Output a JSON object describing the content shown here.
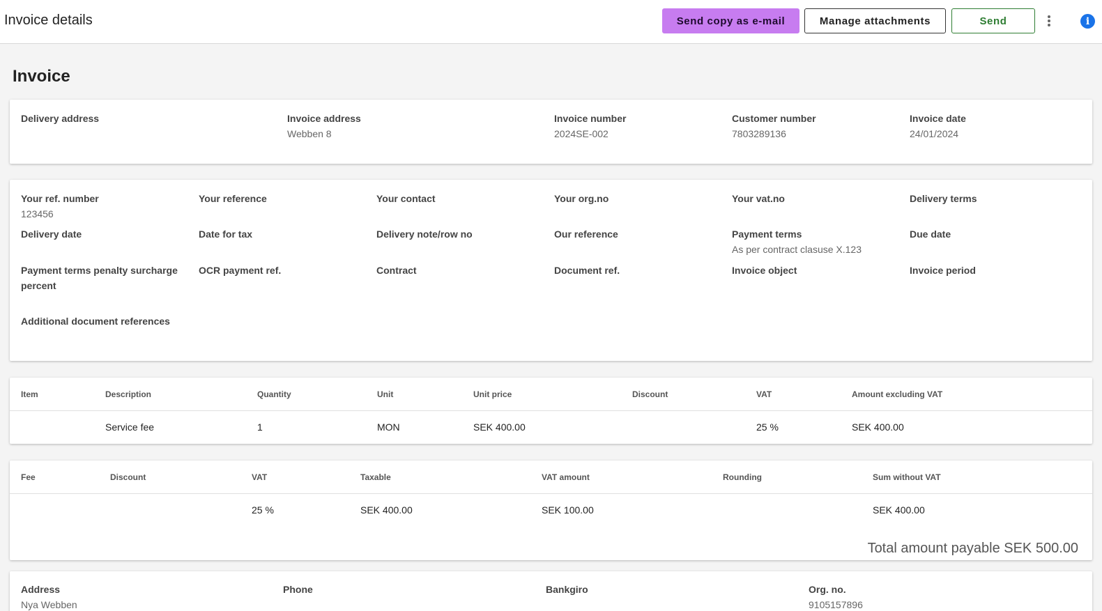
{
  "header": {
    "title": "Invoice details",
    "send_copy_label": "Send copy as e-mail",
    "manage_attachments_label": "Manage attachments",
    "send_label": "Send",
    "info_glyph": "i"
  },
  "page_title": "Invoice",
  "summary": {
    "delivery_address_label": "Delivery address",
    "invoice_address_label": "Invoice address",
    "invoice_address_value": "Webben 8",
    "invoice_number_label": "Invoice number",
    "invoice_number_value": "2024SE-002",
    "customer_number_label": "Customer number",
    "customer_number_value": "7803289136",
    "invoice_date_label": "Invoice date",
    "invoice_date_value": "24/01/2024"
  },
  "references": {
    "your_ref_number_label": "Your ref. number",
    "your_ref_number_value": "123456",
    "your_reference_label": "Your reference",
    "your_contact_label": "Your contact",
    "your_org_no_label": "Your org.no",
    "your_vat_no_label": "Your vat.no",
    "delivery_terms_label": "Delivery terms",
    "delivery_date_label": "Delivery date",
    "date_for_tax_label": "Date for tax",
    "delivery_note_label": "Delivery note/row no",
    "our_reference_label": "Our reference",
    "payment_terms_label": "Payment terms",
    "payment_terms_value": "As per contract clasuse X.123",
    "due_date_label": "Due date",
    "penalty_label_line1": "Payment terms penalty surcharge",
    "penalty_label_line2": "percent",
    "ocr_label": "OCR payment ref.",
    "contract_label": "Contract",
    "document_ref_label": "Document ref.",
    "invoice_object_label": "Invoice object",
    "invoice_period_label": "Invoice period",
    "additional_refs_label": "Additional document references"
  },
  "items_table": {
    "headers": [
      "Item",
      "Description",
      "Quantity",
      "Unit",
      "Unit price",
      "Discount",
      "VAT",
      "Amount excluding VAT"
    ],
    "rows": [
      {
        "item": "",
        "description": "Service fee",
        "quantity": "1",
        "unit": "MON",
        "unit_price": "SEK 400.00",
        "discount": "",
        "vat": "25 %",
        "amount": "SEK 400.00"
      }
    ]
  },
  "fees_table": {
    "headers": [
      "Fee",
      "Discount",
      "VAT",
      "Taxable",
      "VAT amount",
      "Rounding",
      "Sum without VAT"
    ],
    "rows": [
      {
        "fee": "",
        "discount": "",
        "vat": "25 %",
        "taxable": "SEK 400.00",
        "vat_amount": "SEK 100.00",
        "rounding": "",
        "sum": "SEK 400.00"
      }
    ],
    "total": "Total amount payable SEK 500.00"
  },
  "footer": {
    "address_label": "Address",
    "address_value": "Nya Webben",
    "phone_label": "Phone",
    "bankgiro_label": "Bankgiro",
    "org_no_label": "Org. no.",
    "org_no_value": "9105157896"
  },
  "colors": {
    "accent_purple": "#c77cf0",
    "send_green": "#2e7d32",
    "info_blue": "#1a73e8"
  },
  "icons": [
    "more-vertical-icon",
    "info-icon"
  ]
}
